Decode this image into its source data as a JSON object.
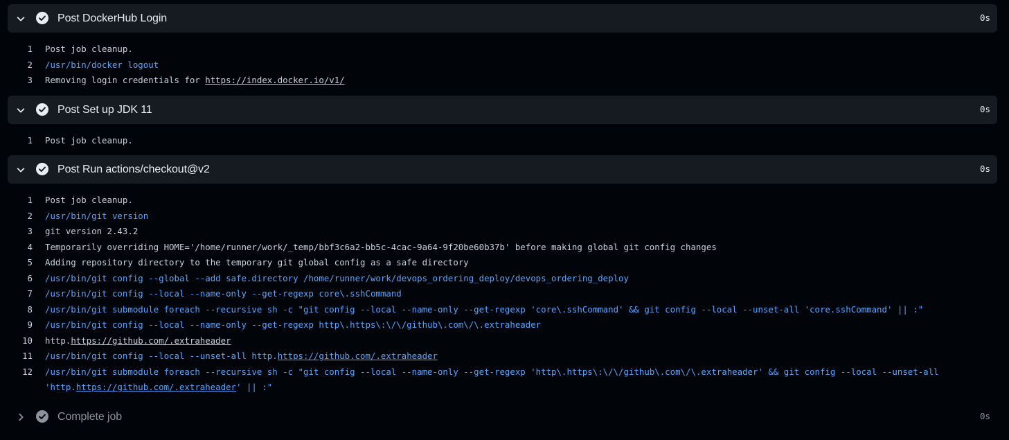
{
  "steps": [
    {
      "title": "Post DockerHub Login",
      "duration": "0s",
      "lines": [
        {
          "n": "1",
          "text": "Post job cleanup."
        },
        {
          "n": "2",
          "text": "/usr/bin/docker logout"
        },
        {
          "n": "3",
          "pre": "Removing login credentials for ",
          "link": "https://index.docker.io/v1/"
        }
      ]
    },
    {
      "title": "Post Set up JDK 11",
      "duration": "0s",
      "lines": [
        {
          "n": "1",
          "text": "Post job cleanup."
        }
      ]
    },
    {
      "title": "Post Run actions/checkout@v2",
      "duration": "0s",
      "lines": [
        {
          "n": "1",
          "text": "Post job cleanup."
        },
        {
          "n": "2",
          "text": "/usr/bin/git version"
        },
        {
          "n": "3",
          "text": "git version 2.43.2"
        },
        {
          "n": "4",
          "text": "Temporarily overriding HOME='/home/runner/work/_temp/bbf3c6a2-bb5c-4cac-9a64-9f20be60b37b' before making global git config changes"
        },
        {
          "n": "5",
          "text": "Adding repository directory to the temporary git global config as a safe directory"
        },
        {
          "n": "6",
          "text": "/usr/bin/git config --global --add safe.directory /home/runner/work/devops_ordering_deploy/devops_ordering_deploy"
        },
        {
          "n": "7",
          "text": "/usr/bin/git config --local --name-only --get-regexp core\\.sshCommand"
        },
        {
          "n": "8",
          "text": "/usr/bin/git submodule foreach --recursive sh -c \"git config --local --name-only --get-regexp 'core\\.sshCommand' && git config --local --unset-all 'core.sshCommand' || :\""
        },
        {
          "n": "9",
          "text": "/usr/bin/git config --local --name-only --get-regexp http\\.https\\:\\/\\/github\\.com\\/\\.extraheader"
        },
        {
          "n": "10",
          "pre": "http.",
          "link": "https://github.com/.extraheader"
        },
        {
          "n": "11",
          "pre": "/usr/bin/git config --local --unset-all http.",
          "link": "https://github.com/.extraheader"
        },
        {
          "n": "12",
          "text": "/usr/bin/git submodule foreach --recursive sh -c \"git config --local --name-only --get-regexp 'http\\.https\\:\\/\\/github\\.com\\/\\.extraheader' && git config --local --unset-all"
        },
        {
          "n": "",
          "pre": "'http.",
          "link": "https://github.com/.extraheader",
          "post": "' || :\""
        }
      ]
    },
    {
      "title": "Complete job",
      "duration": "0s"
    }
  ]
}
